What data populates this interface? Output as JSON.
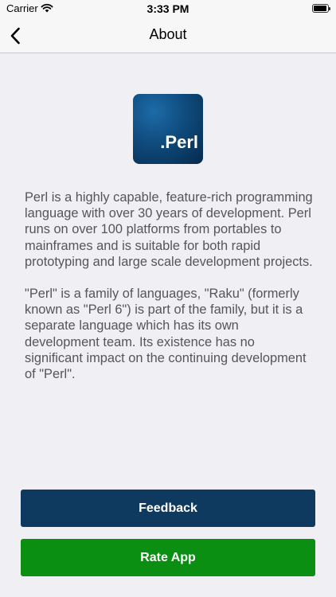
{
  "status_bar": {
    "carrier": "Carrier",
    "time": "3:33 PM"
  },
  "nav": {
    "title": "About"
  },
  "logo": {
    "text": ".Perl"
  },
  "about": {
    "paragraph_1": "Perl is a highly capable, feature-rich programming language with over 30 years of development. Perl runs on over 100 platforms from portables to mainframes and is suitable for both rapid prototyping and large scale development projects.",
    "paragraph_2": "\"Perl\" is a family of languages, \"Raku\" (formerly known as \"Perl 6\") is part of the family, but it is a separate language which has its own development team. Its existence has no significant impact on the continuing development of \"Perl\"."
  },
  "buttons": {
    "feedback": "Feedback",
    "rate_app": "Rate App"
  },
  "colors": {
    "feedback_button": "#0e3a5f",
    "rate_button": "#0a8f13",
    "background": "#efeff4"
  },
  "icons": {
    "back": "chevron-left-icon",
    "wifi": "wifi-icon",
    "battery": "battery-icon"
  }
}
